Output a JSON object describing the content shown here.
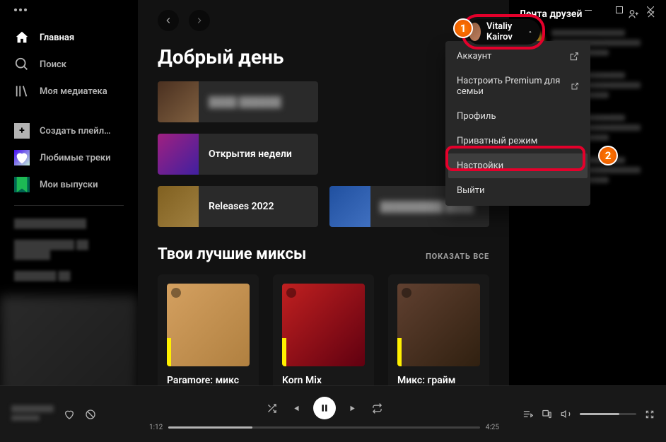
{
  "sidebar": {
    "home": "Главная",
    "search": "Поиск",
    "library": "Моя медиатека",
    "create": "Создать плейл…",
    "liked": "Любимые треки",
    "episodes": "Мои выпуски"
  },
  "header": {
    "user_name": "Vitaliy Kairov"
  },
  "dropdown": {
    "account": "Аккаунт",
    "premium": "Настроить Premium для семьи",
    "profile": "Профиль",
    "private": "Приватный режим",
    "settings": "Настройки",
    "logout": "Выйти"
  },
  "greeting": "Добрый день",
  "cards": {
    "discover": "Открытия недели",
    "releases": "Releases 2022"
  },
  "mixes": {
    "title": "Твои лучшие миксы",
    "show_all": "ПОКАЗАТЬ ВСЕ",
    "m1": "Paramore: микс",
    "m2": "Korn Mix",
    "m3": "Микс: грайм"
  },
  "friends": {
    "title": "Лента друзей"
  },
  "player": {
    "elapsed": "1:12",
    "total": "4:25"
  },
  "annotations": {
    "step1": "1",
    "step2": "2"
  }
}
